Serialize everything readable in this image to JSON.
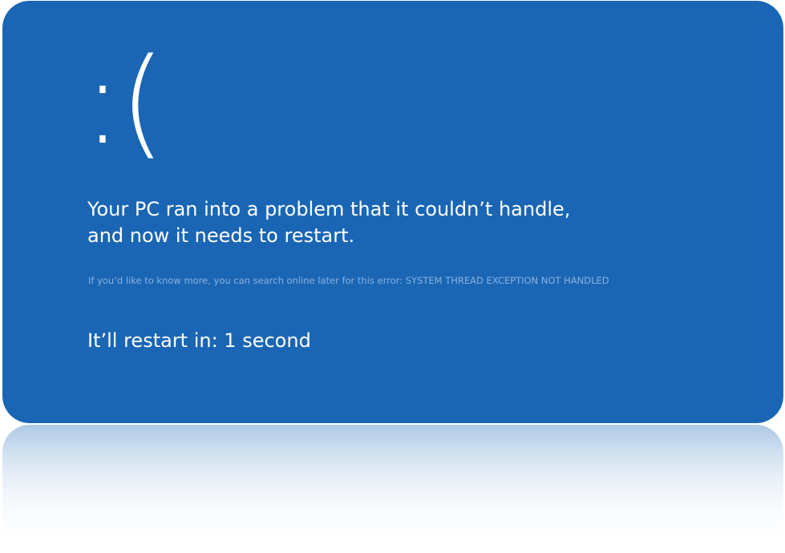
{
  "screen": {
    "background_color": "#1a66b5",
    "sad_face": ":(",
    "headline_line1": "Your PC ran into a problem that it couldn’t handle,",
    "headline_line2": "and now it needs to restart.",
    "error_info": "If you’d like to know more, you can search online later for this error: SYSTEM THREAD EXCEPTION NOT HANDLED",
    "restart_text": "It’ll restart in: 1 second"
  }
}
